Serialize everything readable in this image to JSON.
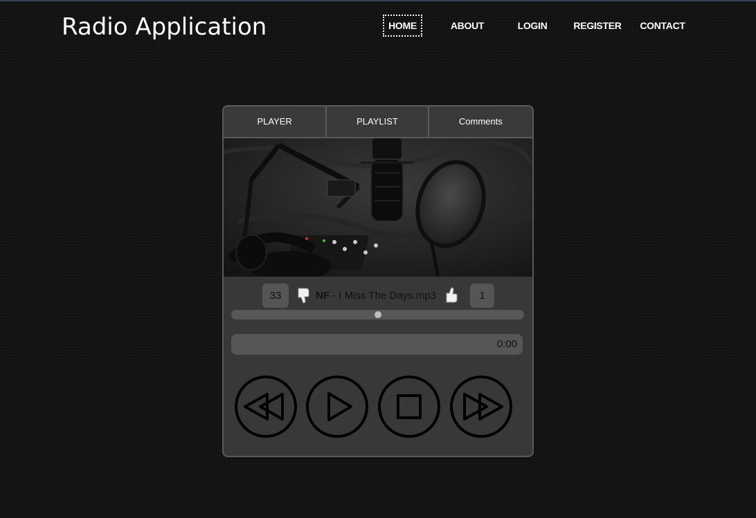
{
  "site": {
    "title": "Radio Application"
  },
  "nav": {
    "items": [
      {
        "label": "HOME"
      },
      {
        "label": "ABOUT"
      },
      {
        "label": "LOGIN"
      },
      {
        "label": "REGISTER"
      },
      {
        "label": "CONTACT"
      }
    ]
  },
  "player": {
    "tabs": [
      {
        "label": "PLAYLIST"
      },
      {
        "label": "PLAYER"
      },
      {
        "label": "Comments"
      }
    ],
    "cover_icon": "studio-microphone-photo",
    "dislikes": "33",
    "likes": "1",
    "dislike_icon": "thumbs-down-icon",
    "like_icon": "thumbs-up-icon",
    "track": {
      "artist": "NF",
      "separator": " - ",
      "title": "I Miss The Days.mp3"
    },
    "progress": 0.5,
    "time": "0:00",
    "controls": {
      "rewind_icon": "rewind-icon",
      "play_icon": "play-icon",
      "stop_icon": "stop-icon",
      "fast_forward_icon": "fast-forward-icon"
    }
  },
  "colors": {
    "background": "#121212",
    "panel": "#383838",
    "panel_border": "#5a5a5a",
    "badge": "#555555"
  }
}
